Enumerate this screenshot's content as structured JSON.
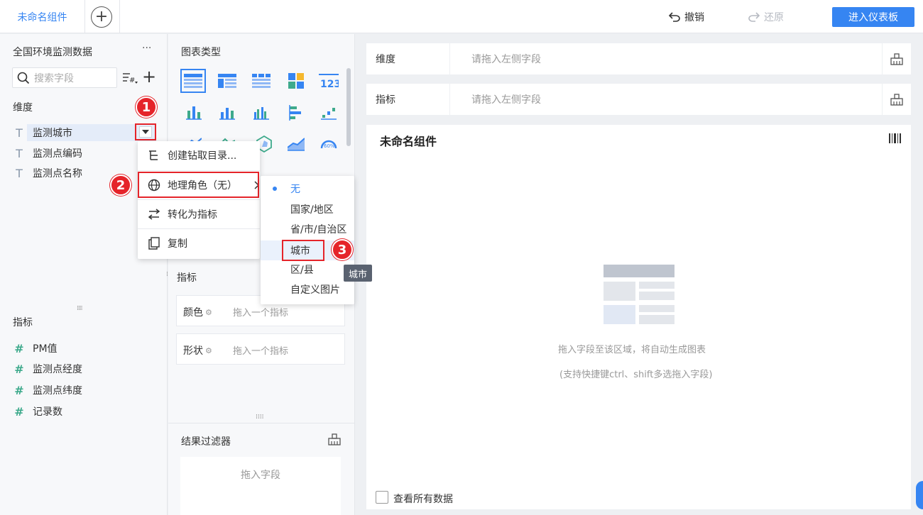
{
  "topbar": {
    "active_tab": "未命名组件",
    "add_tab_symbol": "+",
    "undo_label": "撤销",
    "redo_label": "还原",
    "enter_dashboard": "进入仪表板"
  },
  "left": {
    "dataset_title": "全国环境监测数据",
    "more_symbol": "···",
    "search_placeholder": "搜索字段",
    "dimension_title": "维度",
    "dimensions": [
      "监测城市",
      "监测点编码",
      "监测点名称"
    ],
    "measure_title": "指标",
    "measures": [
      "PM值",
      "监测点经度",
      "监测点纬度",
      "记录数"
    ],
    "dim_type_symbol": "T",
    "measure_type_symbol": "#"
  },
  "middle": {
    "chart_type_title": "图表类型",
    "measure_title": "指标",
    "color_label": "颜色",
    "color_hint": "拖入一个指标",
    "shape_label": "形状",
    "shape_hint": "拖入一个指标",
    "filter_title": "结果过滤器",
    "filter_hint": "拖入字段"
  },
  "context_menu": {
    "items": [
      "创建钻取目录...",
      "地理角色（无）",
      "转化为指标",
      "复制"
    ]
  },
  "geo_submenu": {
    "items": [
      "无",
      "国家/地区",
      "省/市/自治区",
      "城市",
      "区/县",
      "自定义图片"
    ],
    "selected": "无",
    "hovered": "城市",
    "tooltip": "城市"
  },
  "badges": [
    "1",
    "2",
    "3"
  ],
  "right": {
    "dimension_label": "维度",
    "dimension_hint": "请拖入左侧字段",
    "measure_label": "指标",
    "measure_hint": "请拖入左侧字段",
    "component_title": "未命名组件",
    "empty_hint_1": "拖入字段至该区域，将自动生成图表",
    "empty_hint_2": "(支持快捷键ctrl、shift多选拖入字段)",
    "view_all_label": "查看所有数据"
  },
  "colors": {
    "accent": "#3685f2",
    "highlight_red": "#e5242a",
    "dimension_icon": "#8a98ab",
    "measure_icon": "#3eaa8c"
  }
}
